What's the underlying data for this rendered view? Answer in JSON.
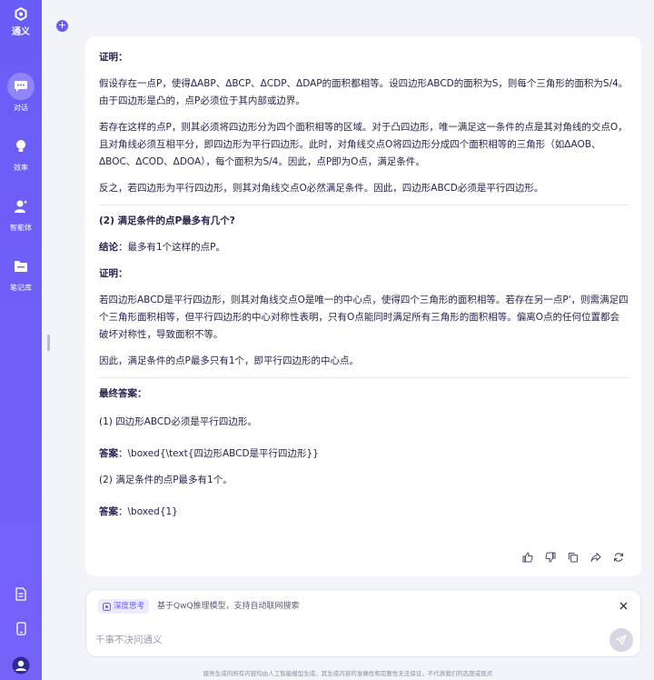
{
  "app": {
    "name": "通义"
  },
  "sidebar": {
    "items": [
      {
        "label": "对话",
        "icon": "chat-icon",
        "active": true
      },
      {
        "label": "效率",
        "icon": "lightbulb-icon",
        "active": false
      },
      {
        "label": "智能体",
        "icon": "agent-icon",
        "active": false
      },
      {
        "label": "笔记库",
        "icon": "folder-icon",
        "active": false
      }
    ],
    "bottom_icons": [
      "document-icon",
      "phone-icon",
      "avatar-icon"
    ]
  },
  "message": {
    "proof1_heading": "证明：",
    "proof1_p1": "假设存在一点P，使得ΔABP、ΔBCP、ΔCDP、ΔDAP的面积都相等。设四边形ABCD的面积为S，则每个三角形的面积为S/4。由于四边形是凸的，点P必须位于其内部或边界。",
    "proof1_p2": "若存在这样的点P，则其必须将四边形分为四个面积相等的区域。对于凸四边形，唯一满足这一条件的点是其对角线的交点O，且对角线必须互相平分，即四边形为平行四边形。此时，对角线交点O将四边形分成四个面积相等的三角形（如ΔAOB、ΔBOC、ΔCOD、ΔDOA），每个面积为S/4。因此，点P即为O点，满足条件。",
    "proof1_p3": "反之，若四边形为平行四边形，则其对角线交点O必然满足条件。因此，四边形ABCD必须是平行四边形。",
    "q2_heading": "(2) 满足条件的点P最多有几个?",
    "conclusion_label": "结论",
    "conclusion_text": "：最多有1个这样的点P。",
    "proof2_heading": "证明：",
    "proof2_p1": "若四边形ABCD是平行四边形，则其对角线交点O是唯一的中心点，使得四个三角形的面积相等。若存在另一点P'，则需满足四个三角形面积相等，但平行四边形的中心对称性表明，只有O点能同时满足所有三角形的面积相等。偏离O点的任何位置都会破坏对称性，导致面积不等。",
    "proof2_p2": "因此，满足条件的点P最多只有1个，即平行四边形的中心点。",
    "final_heading": "最终答案：",
    "final_1": "(1) 四边形ABCD必须是平行四边形。",
    "answer_label": "答案",
    "answer_1": "：\\boxed{\\text{四边形ABCD是平行四边形}}",
    "final_2": "(2) 满足条件的点P最多有1个。",
    "answer_2": "：\\boxed{1}"
  },
  "message_actions": [
    "thumbs-up-icon",
    "thumbs-down-icon",
    "copy-icon",
    "share-icon",
    "regenerate-icon"
  ],
  "input": {
    "deep_think_label": "深度思考",
    "deep_think_desc": "基于QwQ推理模型，支持自动联网搜索",
    "placeholder": "千事不决问通义"
  },
  "disclaimer": "服务生成的所有内容均由人工智能模型生成，其生成内容的准确性和完整性无法保证，不代表我们的态度或观点",
  "colors": {
    "accent": "#6a5cf6",
    "sidebar": "#6f5ff7",
    "text": "#26244c"
  }
}
